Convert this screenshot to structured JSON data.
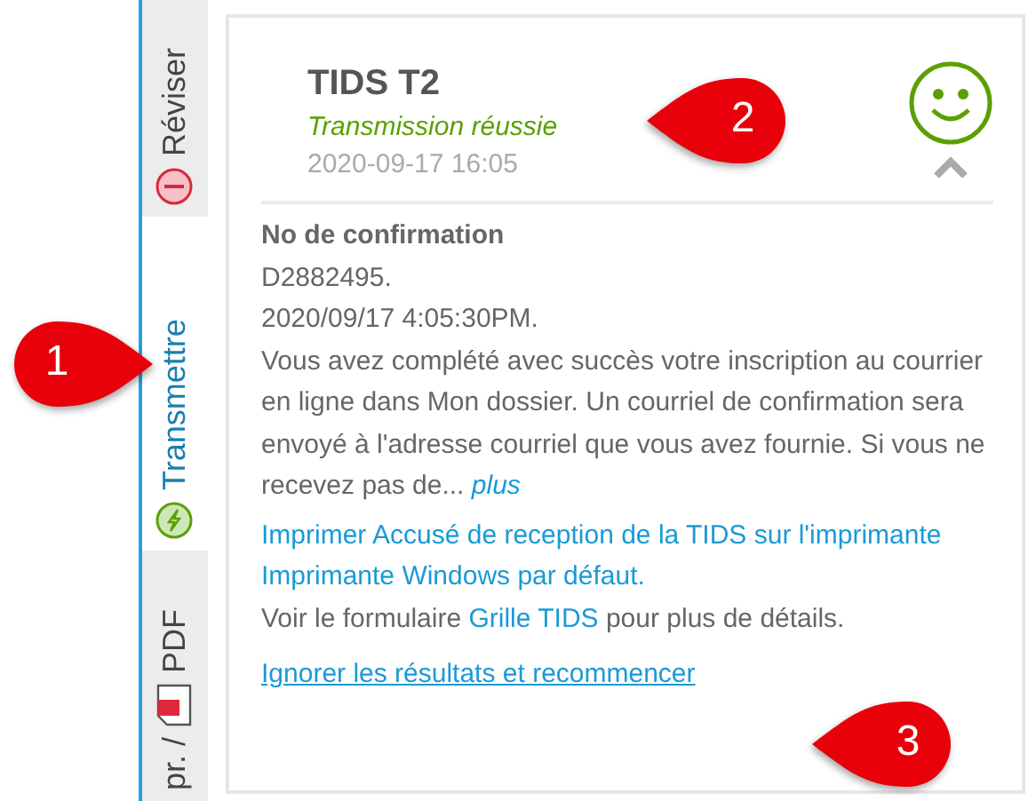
{
  "tabs": [
    {
      "label": "Réviser",
      "selected": false
    },
    {
      "label": "Transmettre",
      "selected": true
    },
    {
      "prefix": "pr. /",
      "label": "PDF",
      "selected": false
    }
  ],
  "card": {
    "title": "TIDS T2",
    "status": "Transmission réussie",
    "timestamp": "2020-09-17 16:05",
    "expanded": true,
    "confirmation_label": "No de confirmation",
    "lines": [
      "D2882495.",
      "2020/09/17 4:05:30PM."
    ],
    "message": "Vous avez complété avec succès votre inscription au courrier en ligne dans Mon dossier. Un courriel de confirmation sera envoyé à l'adresse courriel que vous avez fournie. Si vous ne recevez pas de...",
    "more_link": "plus",
    "print_link": "Imprimer Accusé de reception de la TIDS sur l'imprimante Imprimante Windows par défaut.",
    "form_note_before": "Voir le formulaire ",
    "form_link": "Grille TIDS",
    "form_note_after": " pour plus de détails.",
    "reset_link": "Ignorer les résultats et recommencer"
  },
  "callouts": [
    {
      "number": "1"
    },
    {
      "number": "2"
    },
    {
      "number": "3"
    }
  ]
}
